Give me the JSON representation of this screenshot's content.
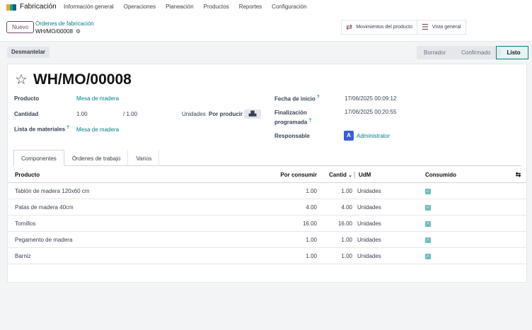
{
  "app": {
    "name": "Fabricación",
    "menu": [
      "Información general",
      "Operaciones",
      "Planeación",
      "Productos",
      "Reportes",
      "Configuración"
    ],
    "icon_colors": [
      "#e8a33d",
      "#1ea672",
      "#0f5f8a"
    ]
  },
  "control": {
    "new_label": "Nuevo",
    "breadcrumb_parent": "Órdenes de fabricación",
    "breadcrumb_current": "WH/MO/00008",
    "smart_buttons": [
      {
        "label": "Movimientos del producto",
        "icon": "transfer-arrows-icon"
      },
      {
        "label": "Vista general",
        "icon": "list-bars-icon"
      }
    ]
  },
  "status": {
    "dismantle_label": "Desmantelar",
    "stages": [
      "Borrador",
      "Confirmado",
      "Listo"
    ],
    "active_stage": "Listo"
  },
  "form": {
    "title": "WH/MO/00008",
    "product_label": "Producto",
    "product_value": "Mesa de madera",
    "quantity_label": "Cantidad",
    "quantity_value": "1.00",
    "quantity_total": "/ 1.00",
    "quantity_unit": "Unidades",
    "to_produce_label": "Por producir",
    "bom_label": "Lista de materiales",
    "bom_value": "Mesa de madera",
    "start_label": "Fecha de inicio",
    "start_value": "17/06/2025 00:09:12",
    "end_label_1": "Finalización",
    "end_label_2": "programada",
    "end_value": "17/06/2025 00:20:55",
    "responsible_label": "Responsable",
    "responsible_initial": "A",
    "responsible_value": "Administrator",
    "help_mark": "?"
  },
  "tabs": [
    "Componentes",
    "Órdenes de trabajo",
    "Varios"
  ],
  "table": {
    "headers": {
      "product": "Producto",
      "to_consume": "Por consumir",
      "quantity": "Cantid",
      "uom": "UdM",
      "consumed": "Consumido"
    },
    "rows": [
      {
        "product": "Tablón de madera 120x60 cm",
        "to_consume": "1.00",
        "quantity": "1.00",
        "uom": "Unidades",
        "consumed": true
      },
      {
        "product": "Patas de madera 40cm",
        "to_consume": "4.00",
        "quantity": "4.00",
        "uom": "Unidades",
        "consumed": true
      },
      {
        "product": "Tornillos",
        "to_consume": "16.00",
        "quantity": "16.00",
        "uom": "Unidades",
        "consumed": true
      },
      {
        "product": "Pegamento de madera",
        "to_consume": "1.00",
        "quantity": "1.00",
        "uom": "Unidades",
        "consumed": true
      },
      {
        "product": "Barniz",
        "to_consume": "1.00",
        "quantity": "1.00",
        "uom": "Unidades",
        "consumed": true
      }
    ]
  }
}
